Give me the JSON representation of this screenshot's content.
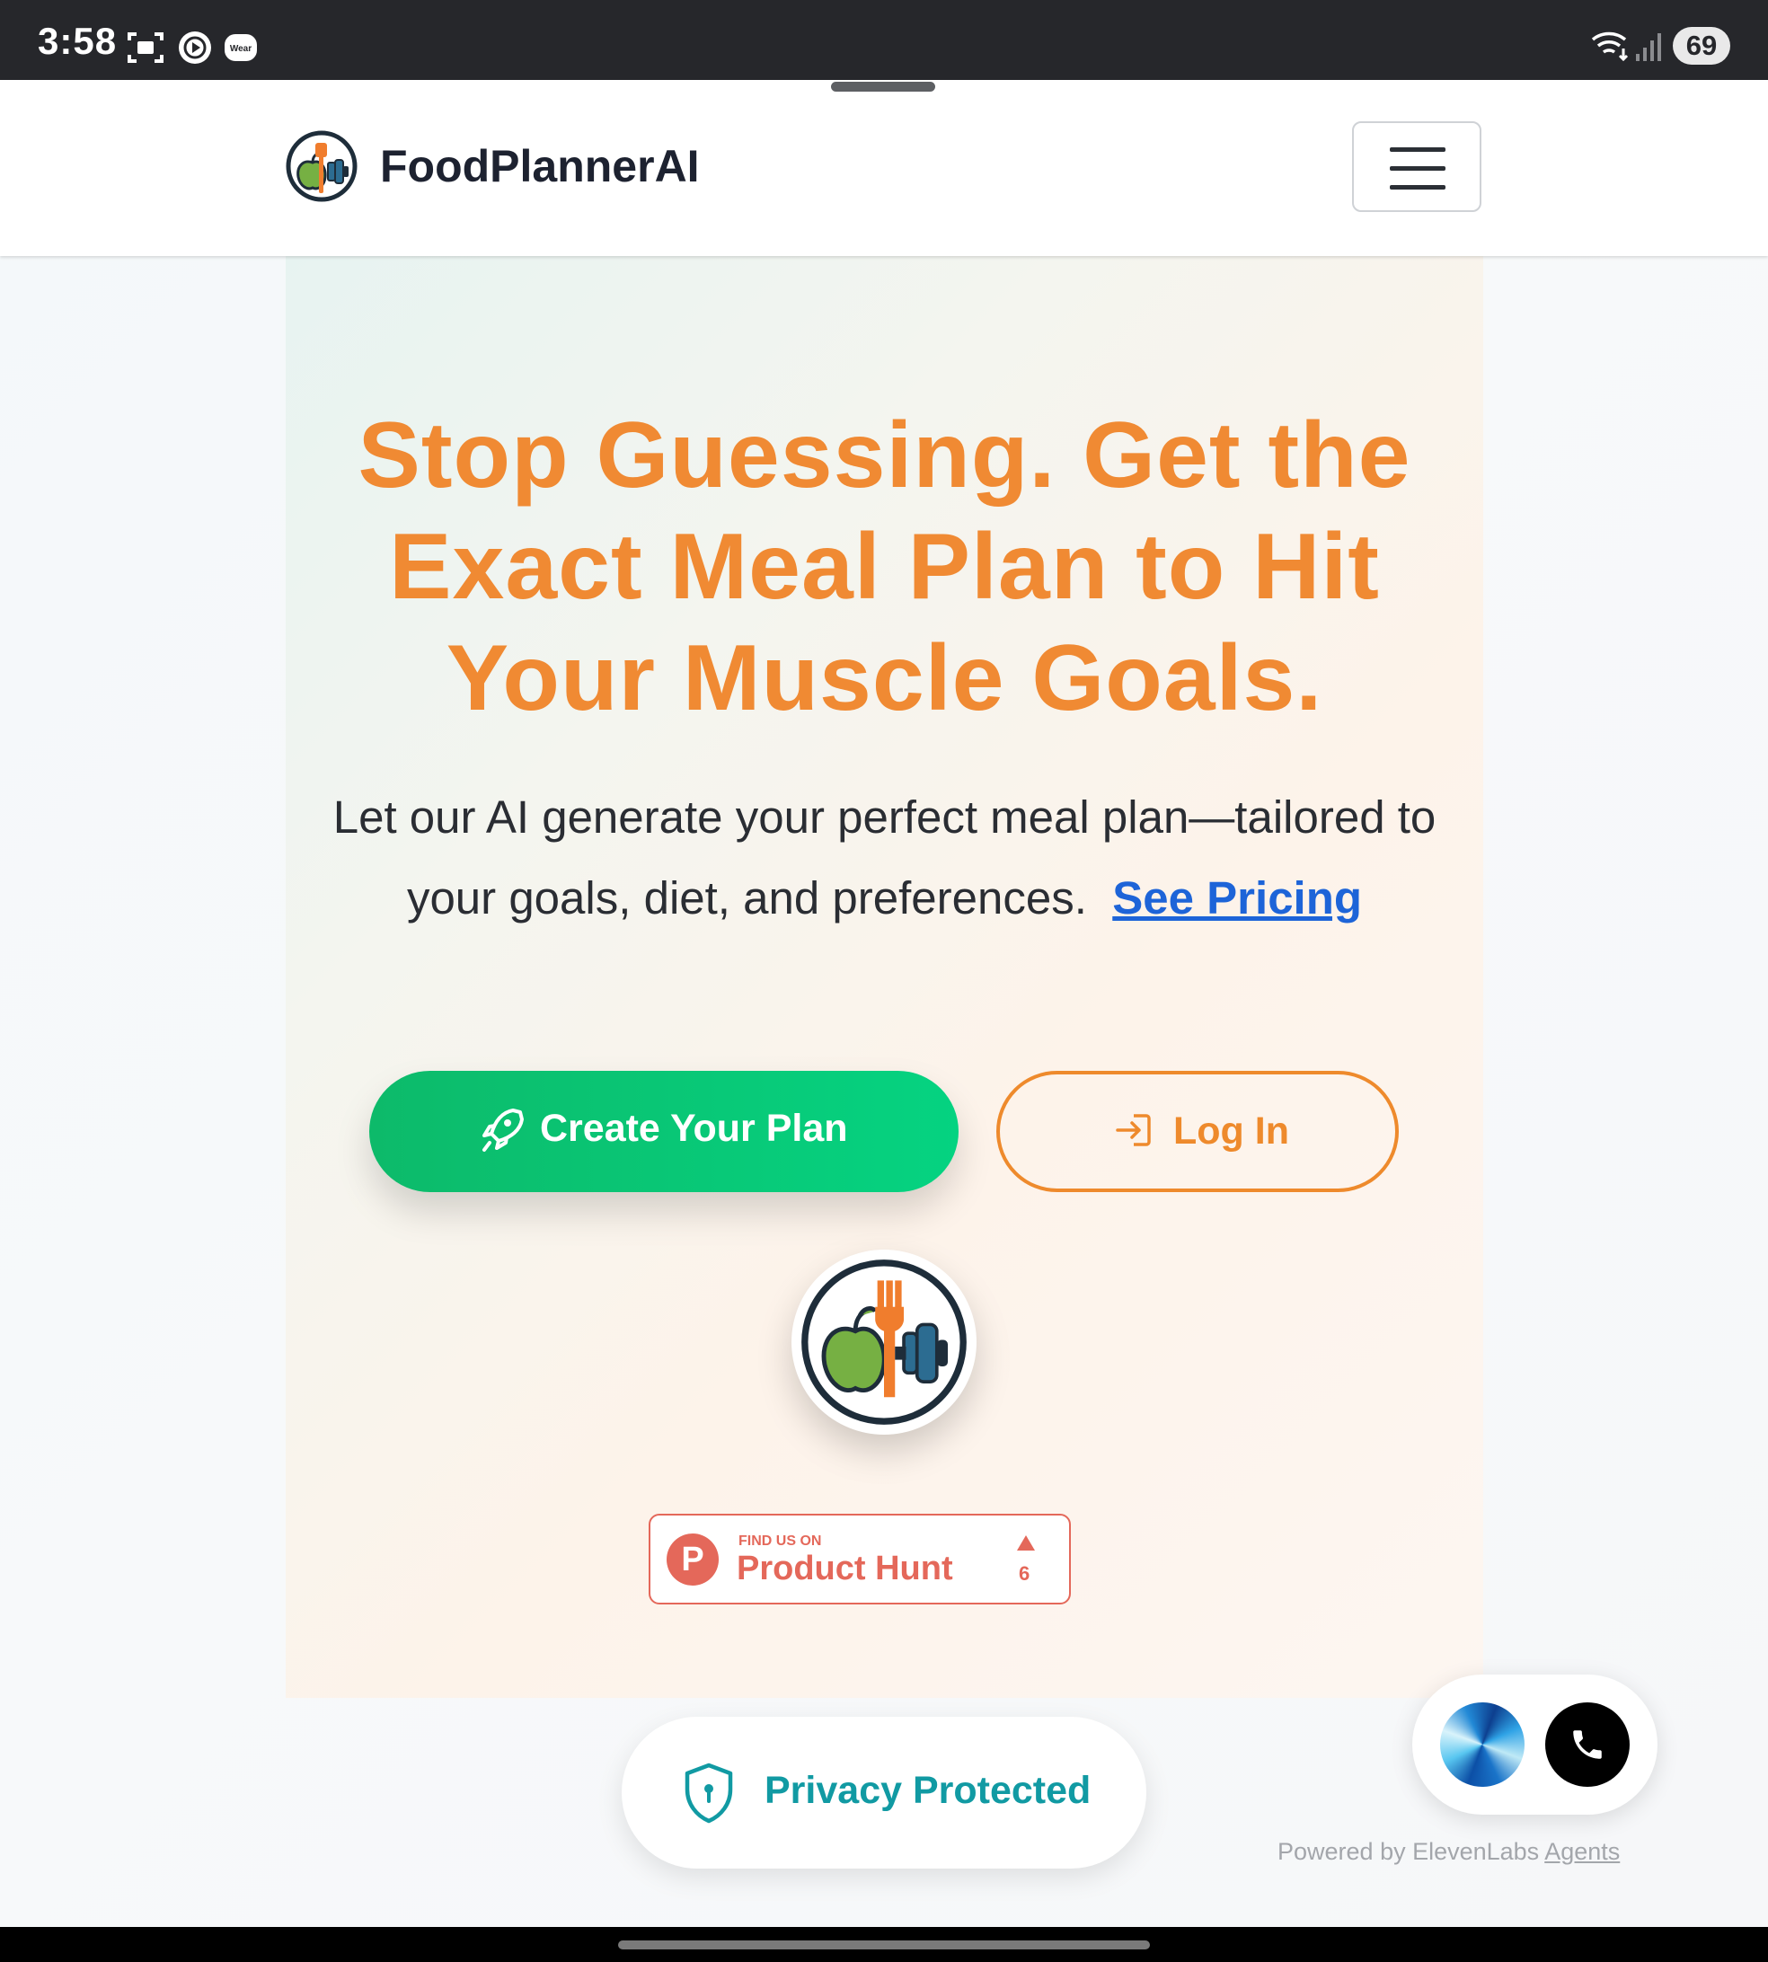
{
  "status_bar": {
    "time": "3:58",
    "icons": [
      "screenshot-icon",
      "play-circle-icon",
      "wear-icon",
      "wifi-icon",
      "signal-icon"
    ],
    "battery": "69"
  },
  "navbar": {
    "brand_name": "FoodPlannerAI",
    "menu_icon": "hamburger-icon"
  },
  "hero": {
    "headline": "Stop Guessing. Get the Exact Meal Plan to Hit Your Muscle Goals.",
    "subtext": "Let our AI generate your perfect meal plan—tailored to your goals, diet, and preferences.",
    "pricing_link": "See Pricing",
    "create_button": "Create Your Plan",
    "login_button": "Log In",
    "colors": {
      "accent_orange": "#f08a33",
      "accent_green": "#0dba6a",
      "link_blue": "#1d64d8"
    }
  },
  "product_hunt": {
    "eyebrow": "FIND US ON",
    "name": "Product Hunt",
    "letter": "P",
    "upvotes": "6"
  },
  "privacy": {
    "label": "Privacy Protected"
  },
  "agent_widget": {
    "powered_prefix": "Powered by ElevenLabs",
    "powered_link": "Agents"
  }
}
